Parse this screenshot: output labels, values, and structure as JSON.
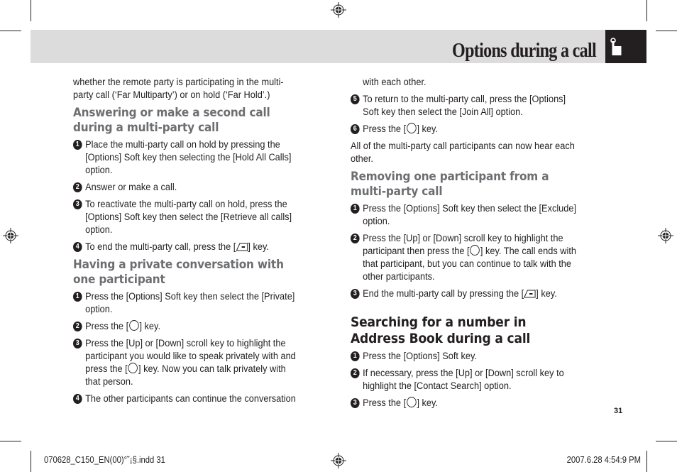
{
  "header": {
    "title": "Options during a call",
    "tab_icon": "hand-pointer-icon",
    "band_color": "#dcdcdc",
    "tab_color": "#231f20"
  },
  "left_column": {
    "intro": "whether the remote party is participating in the multi-party call (‘Far Multiparty’) or on hold (‘Far Hold’.)",
    "sections": [
      {
        "heading": "Answering or make a second call during a multi-party call",
        "steps": [
          {
            "num": "1",
            "parts": [
              "Place the multi-party call on hold by pressing the [Options] Soft key then selecting the [Hold All Calls] option."
            ]
          },
          {
            "num": "2",
            "parts": [
              "Answer or make a call."
            ]
          },
          {
            "num": "3",
            "parts": [
              "To reactivate the multi-party call on hold, press the [Options] Soft key then select the [Retrieve all calls] option."
            ]
          },
          {
            "num": "4",
            "parts": [
              "To end the multi-party call, press the [",
              "] key."
            ],
            "key": "end-key-icon"
          }
        ]
      },
      {
        "heading": "Having a private conversation with one participant",
        "steps": [
          {
            "num": "1",
            "parts": [
              "Press the [Options] Soft key then select the [Private] option."
            ]
          },
          {
            "num": "2",
            "parts": [
              "Press the [",
              "] key."
            ],
            "key": "ok-key-icon"
          },
          {
            "num": "3",
            "parts": [
              "Press the [Up] or [Down] scroll key to highlight the participant you would like to speak privately with and press the  [",
              "] key. Now you can talk privately with that person."
            ],
            "key": "ok-key-icon"
          },
          {
            "num": "4",
            "parts": [
              "The other participants can continue the conversation"
            ]
          }
        ]
      }
    ]
  },
  "right_column": {
    "continuation": "with each other.",
    "steps_cont": [
      {
        "num": "5",
        "parts": [
          "To return to the multi-party call, press the [Options] Soft key then select the [Join All] option."
        ]
      },
      {
        "num": "6",
        "parts": [
          "Press the [",
          "] key."
        ],
        "key": "ok-key-icon"
      }
    ],
    "note": "All of the multi-party call participants can now hear each other.",
    "sections": [
      {
        "heading": "Removing one participant from a multi-party call",
        "steps": [
          {
            "num": "1",
            "parts": [
              "Press the [Options] Soft key then select the [Exclude] option."
            ]
          },
          {
            "num": "2",
            "parts": [
              "Press the [Up] or [Down] scroll key to highlight the participant then press the [",
              "] key. The call ends with that participant, but you can continue to talk with the other participants."
            ],
            "key": "ok-key-icon"
          },
          {
            "num": "3",
            "parts": [
              "End the multi-party call by pressing the [",
              "] key."
            ],
            "key": "end-key-icon"
          }
        ]
      },
      {
        "heading": "Searching for a number in Address Book during a call",
        "dark": true,
        "steps": [
          {
            "num": "1",
            "parts": [
              "Press the [Options] Soft key."
            ]
          },
          {
            "num": "2",
            "parts": [
              "If necessary, press the [Up] or [Down] scroll key to highlight the [Contact Search] option."
            ]
          },
          {
            "num": "3",
            "parts": [
              "Press the [",
              "] key."
            ],
            "key": "ok-key-icon"
          }
        ]
      }
    ]
  },
  "page_number": "31",
  "footer": {
    "file_slug": "070628_C150_EN(00)°˘¡§.indd   31",
    "timestamp": "2007.6.28   4:54:9 PM"
  }
}
